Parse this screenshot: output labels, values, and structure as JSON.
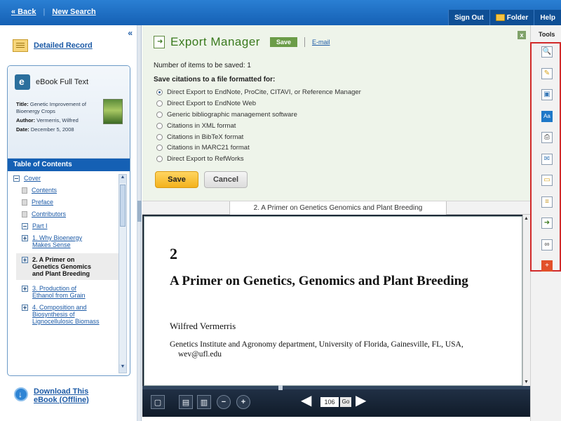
{
  "topbar": {
    "back": "« Back",
    "new_search": "New Search",
    "sign_out": "Sign Out",
    "folder": "Folder",
    "help": "Help"
  },
  "left": {
    "collapse": "«",
    "detailed_record": "Detailed Record",
    "ebook_label": "eBook Full Text",
    "meta": {
      "title_label": "Title:",
      "title": "Genetic Improvement of Bioenergy Crops",
      "author_label": "Author:",
      "author": "Vermerris, Wilfred",
      "date_label": "Date:",
      "date": "December 5, 2008"
    },
    "toc_header": "Table of Contents",
    "toc": [
      {
        "label": "Cover",
        "kind": "minus"
      },
      {
        "label": "Contents",
        "kind": "page"
      },
      {
        "label": "Preface",
        "kind": "page"
      },
      {
        "label": "Contributors",
        "kind": "page"
      },
      {
        "label": "Part I",
        "kind": "minus"
      },
      {
        "label": "1. Why Bioenergy Makes Sense",
        "kind": "plus"
      },
      {
        "label": "2. A Primer on Genetics Genomics and Plant Breeding",
        "kind": "plus",
        "selected": true
      },
      {
        "label": "3. Production of Ethanol from Grain",
        "kind": "plus"
      },
      {
        "label": "4. Composition and Biosynthesis of Lignocellulosic Biomass",
        "kind": "plus"
      }
    ],
    "download": "Download This eBook (Offline)"
  },
  "export": {
    "title": "Export Manager",
    "save_tag": "Save",
    "email": "E-mail",
    "close": "x",
    "count_text": "Number of items to be saved: 1",
    "format_title": "Save citations to a file formatted for:",
    "options": [
      "Direct Export to EndNote, ProCite, CITAVI, or Reference Manager",
      "Direct Export to EndNote Web",
      "Generic bibliographic management software",
      "Citations in XML format",
      "Citations in BibTeX format",
      "Citations in MARC21 format",
      "Direct Export to RefWorks"
    ],
    "selected_option": 0,
    "save_button": "Save",
    "cancel_button": "Cancel"
  },
  "viewer": {
    "chapter_tab": "2. A Primer on Genetics Genomics and Plant Breeding",
    "chapter_number": "2",
    "chapter_title": "A Primer on Genetics, Genomics and Plant Breeding",
    "author": "Wilfred Vermerris",
    "affiliation": "Genetics Institute and Agronomy department, University of Florida, Gainesville, FL, USA,",
    "email": "wev@ufl.edu",
    "page_number": "106",
    "go": "Go"
  },
  "tools": {
    "title": "Tools",
    "items": [
      "search-icon",
      "note-icon",
      "image-icon",
      "font-size-icon",
      "print-icon",
      "email-icon",
      "folder-icon",
      "notes-icon",
      "export-icon",
      "link-icon",
      "add-icon"
    ]
  },
  "colors": {
    "brand": "#1560b4",
    "export_green": "#3a7a1e",
    "save_yellow": "#f3b21d",
    "tools_frame": "#d12a2a"
  }
}
